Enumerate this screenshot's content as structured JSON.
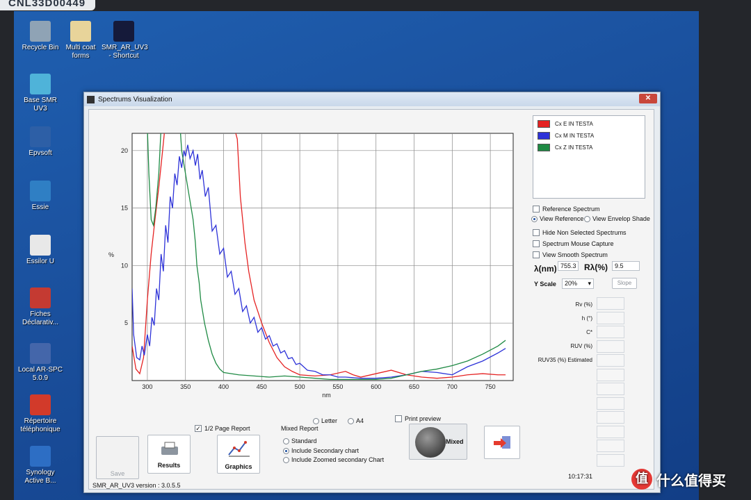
{
  "sticker_label": "CNL33D00449",
  "desktop_icons": [
    {
      "label": "Recycle Bin",
      "color": "#8fa3b5"
    },
    {
      "label": "Multi coat forms",
      "color": "#e8d49a"
    },
    {
      "label": "SMR_AR_UV3 - Shortcut",
      "color": "#151a3a"
    },
    {
      "label": "Base SMR UV3",
      "color": "#4fb3d9"
    },
    {
      "label": "Epvsoft",
      "color": "#2d5fa6"
    },
    {
      "label": "Essie",
      "color": "#2f7fc4"
    },
    {
      "label": "Essilor U",
      "color": "#e8e8e8"
    },
    {
      "label": "Fiches Déclarativ...",
      "color": "#c43a32"
    },
    {
      "label": "Local AR-SPC 5.0.9",
      "color": "#4466aa"
    },
    {
      "label": "Répertoire téléphonique",
      "color": "#d23a2a"
    },
    {
      "label": "Synology Active B...",
      "color": "#2d6ec4"
    }
  ],
  "window": {
    "title": "Spectrums Visualization",
    "close_label": "✕",
    "version": "SMR_AR_UV3 version : 3.0.5.5",
    "time": "10:17:31"
  },
  "legend": [
    {
      "name": "Cx E IN TESTA",
      "color": "#e52222"
    },
    {
      "name": "Cx M IN TESTA",
      "color": "#2d32d8"
    },
    {
      "name": "Cx Z IN TESTA",
      "color": "#1f8a44"
    }
  ],
  "options": {
    "reference_spectrum": "Reference Spectrum",
    "view_reference": "View Reference",
    "view_envelop_shade": "View Envelop Shade",
    "hide_non_selected": "Hide Non Selected Spectrums",
    "mouse_capture": "Spectrum Mouse Capture",
    "smooth_spectrum": "View Smooth Spectrum",
    "lambda_label": "λ(nm)",
    "lambda_value": "755.3",
    "r_label": "Rλ(%)",
    "r_value": "9.5",
    "y_scale_label": "Y Scale",
    "y_scale_value": "20%",
    "slope_label": "Slope"
  },
  "results": {
    "labels": [
      "Rv (%)",
      "h (°)",
      "C*",
      "RUV (%)",
      "RUV35 (%) Estimated"
    ]
  },
  "bottom": {
    "save_label": "Save",
    "results_label": "Results",
    "half_page_label": "1/2 Page Report",
    "graphics_label": "Graphics",
    "letter_label": "Letter",
    "a4_label": "A4",
    "print_preview_label": "Print preview",
    "mixed_report_label": "Mixed Report",
    "standard_label": "Standard",
    "include_secondary_label": "Include Secondary chart",
    "include_zoomed_label": "Include Zoomed secondary Chart",
    "mixed_label": "Mixed"
  },
  "watermark_text": "什么值得买",
  "chart_data": {
    "type": "line",
    "xlabel": "nm",
    "ylabel": "%",
    "xlim": [
      280,
      780
    ],
    "ylim": [
      0,
      21.5
    ],
    "xticks": [
      300,
      350,
      400,
      450,
      500,
      550,
      600,
      650,
      700,
      750
    ],
    "yticks": [
      5,
      10,
      15,
      20
    ],
    "grid": true,
    "series": [
      {
        "name": "Cx E IN TESTA",
        "color": "#e52222",
        "points": [
          [
            280,
            3
          ],
          [
            285,
            1
          ],
          [
            290,
            0.6
          ],
          [
            295,
            2
          ],
          [
            300,
            7
          ],
          [
            305,
            11
          ],
          [
            310,
            14
          ],
          [
            315,
            16.8
          ],
          [
            320,
            20
          ],
          [
            323,
            22
          ],
          [
            330,
            25
          ],
          [
            340,
            26
          ],
          [
            360,
            26
          ],
          [
            380,
            25
          ],
          [
            400,
            24
          ],
          [
            410,
            23
          ],
          [
            418,
            21
          ],
          [
            422,
            16
          ],
          [
            428,
            12
          ],
          [
            433,
            9.5
          ],
          [
            440,
            7
          ],
          [
            450,
            5
          ],
          [
            460,
            3.3
          ],
          [
            470,
            2
          ],
          [
            480,
            1.2
          ],
          [
            490,
            0.8
          ],
          [
            500,
            0.5
          ],
          [
            520,
            0.4
          ],
          [
            540,
            0.5
          ],
          [
            560,
            0.8
          ],
          [
            570,
            0.5
          ],
          [
            580,
            0.3
          ],
          [
            600,
            0.6
          ],
          [
            620,
            0.9
          ],
          [
            640,
            0.5
          ],
          [
            660,
            0.3
          ],
          [
            680,
            0.2
          ],
          [
            700,
            0.3
          ],
          [
            720,
            0.5
          ],
          [
            740,
            0.6
          ],
          [
            760,
            0.5
          ],
          [
            770,
            0.5
          ]
        ]
      },
      {
        "name": "Cx M IN TESTA",
        "color": "#2d32d8",
        "points": [
          [
            280,
            8
          ],
          [
            282,
            4
          ],
          [
            286,
            2
          ],
          [
            290,
            1.8
          ],
          [
            293,
            3
          ],
          [
            296,
            2.2
          ],
          [
            300,
            4
          ],
          [
            303,
            3
          ],
          [
            306,
            5.5
          ],
          [
            309,
            4.8
          ],
          [
            312,
            8
          ],
          [
            315,
            7
          ],
          [
            318,
            11
          ],
          [
            321,
            9.5
          ],
          [
            324,
            13.5
          ],
          [
            327,
            12
          ],
          [
            330,
            16
          ],
          [
            333,
            15
          ],
          [
            336,
            18
          ],
          [
            339,
            17
          ],
          [
            342,
            19.5
          ],
          [
            345,
            18.5
          ],
          [
            348,
            20
          ],
          [
            350,
            19.5
          ],
          [
            353,
            20.5
          ],
          [
            356,
            19.3
          ],
          [
            360,
            20
          ],
          [
            363,
            18.7
          ],
          [
            366,
            19.7
          ],
          [
            369,
            17.5
          ],
          [
            372,
            18.3
          ],
          [
            376,
            16
          ],
          [
            380,
            16.8
          ],
          [
            385,
            13
          ],
          [
            390,
            13.5
          ],
          [
            395,
            11
          ],
          [
            400,
            11.5
          ],
          [
            405,
            9
          ],
          [
            410,
            9.5
          ],
          [
            415,
            7.5
          ],
          [
            420,
            8
          ],
          [
            425,
            6
          ],
          [
            430,
            6.5
          ],
          [
            435,
            5
          ],
          [
            440,
            5.5
          ],
          [
            445,
            4.2
          ],
          [
            450,
            4.6
          ],
          [
            455,
            3.6
          ],
          [
            460,
            3.9
          ],
          [
            465,
            3
          ],
          [
            470,
            3.2
          ],
          [
            475,
            2.4
          ],
          [
            480,
            2.6
          ],
          [
            485,
            1.9
          ],
          [
            490,
            2
          ],
          [
            495,
            1.4
          ],
          [
            500,
            1.5
          ],
          [
            510,
            0.9
          ],
          [
            520,
            0.8
          ],
          [
            530,
            0.5
          ],
          [
            540,
            0.5
          ],
          [
            550,
            0.3
          ],
          [
            560,
            0.3
          ],
          [
            580,
            0.2
          ],
          [
            600,
            0.2
          ],
          [
            620,
            0.3
          ],
          [
            640,
            0.5
          ],
          [
            660,
            0.8
          ],
          [
            680,
            0.7
          ],
          [
            700,
            0.5
          ],
          [
            720,
            1.2
          ],
          [
            740,
            1.7
          ],
          [
            760,
            2.4
          ],
          [
            770,
            2.8
          ]
        ]
      },
      {
        "name": "Cx Z IN TESTA",
        "color": "#1f8a44",
        "points": [
          [
            340,
            25
          ],
          [
            345,
            20
          ],
          [
            350,
            18
          ],
          [
            355,
            16
          ],
          [
            360,
            14
          ],
          [
            363,
            12
          ],
          [
            365,
            10
          ],
          [
            368,
            8.5
          ],
          [
            370,
            7
          ],
          [
            375,
            5
          ],
          [
            380,
            3.5
          ],
          [
            385,
            2.3
          ],
          [
            390,
            1.5
          ],
          [
            395,
            1
          ],
          [
            400,
            0.7
          ],
          [
            420,
            0.5
          ],
          [
            440,
            0.4
          ],
          [
            460,
            0.3
          ],
          [
            480,
            0.4
          ],
          [
            500,
            0.3
          ],
          [
            520,
            0.2
          ],
          [
            540,
            0.1
          ],
          [
            560,
            0.1
          ],
          [
            580,
            0.1
          ],
          [
            600,
            0.1
          ],
          [
            620,
            0.2
          ],
          [
            640,
            0.5
          ],
          [
            660,
            0.8
          ],
          [
            680,
            1
          ],
          [
            700,
            1.3
          ],
          [
            720,
            1.7
          ],
          [
            740,
            2.3
          ],
          [
            760,
            3
          ],
          [
            770,
            3.5
          ]
        ]
      }
    ],
    "extra_green_left": [
      [
        300,
        22
      ],
      [
        302,
        18
      ],
      [
        305,
        14
      ],
      [
        308,
        13.5
      ],
      [
        311,
        15
      ],
      [
        315,
        18
      ],
      [
        318,
        22
      ]
    ]
  }
}
